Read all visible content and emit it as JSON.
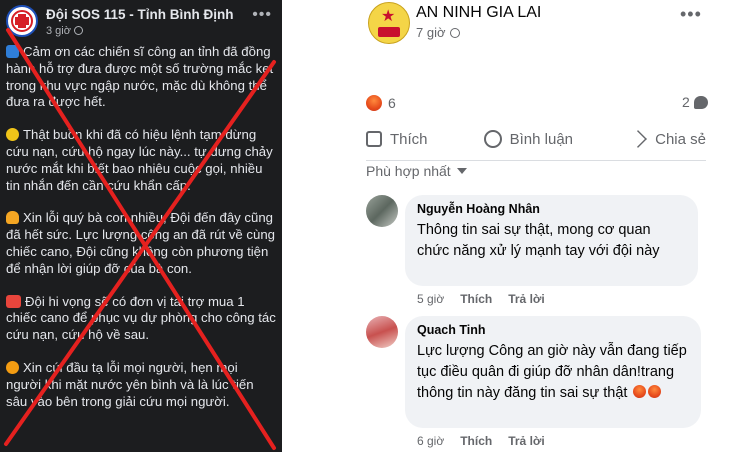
{
  "left_post": {
    "page_name": "Đội SOS 115 - Tỉnh Bình Định",
    "time": "3 giờ",
    "paragraphs": [
      "Cảm ơn các chiến sĩ công an tỉnh đã đồng hành hỗ trợ đưa được một số trường mắc kẹt trong khu vực ngập nước, mặc dù không thể đưa ra được hết.",
      "Thật buồn khi đã có hiệu lệnh tạm dừng cứu nạn, cứu hộ ngay lúc này... tự dưng chảy nước mắt khi biết bao nhiêu cuộc gọi, nhiều tin nhắn đến cần cứu khẩn cấp.",
      "Xin lỗi quý bà con nhiều, Đội đến đây cũng đã hết sức. Lực lượng công an đã rút về cùng chiếc cano, Đội cũng không còn phương tiện để nhận lời giúp đỡ của bà con.",
      "Đội hi vọng sẽ có đơn vị tài trợ mua 1 chiếc cano để phục vụ dự phòng cho công tác cứu nạn, cứu hộ về sau.",
      "Xin cúi đầu tạ lỗi mọi người, hẹn mọi người khi mặt nước yên bình và là lúc tiến sâu vào bên trong giải cứu mọi người."
    ],
    "emoji_icons": [
      "ship-icon",
      "sad-face-icon",
      "pray-icon",
      "sos-icon",
      "bowing-icon"
    ],
    "overlay_color": "#e5211f"
  },
  "right_post": {
    "page_name": "AN NINH GIA LAI",
    "time": "7 giờ",
    "reaction_count": "6",
    "comment_count": "2",
    "actions": {
      "like": "Thích",
      "comment": "Bình luận",
      "share": "Chia sẻ"
    },
    "sort_label": "Phù hợp nhất",
    "comments": [
      {
        "author": "Nguyễn Hoàng Nhân",
        "text": "Thông tin sai sự thật, mong cơ quan chức năng xử lý mạnh tay với đội này",
        "time": "5 giờ",
        "like": "Thích",
        "reply": "Trả lời"
      },
      {
        "author": "Quach Tinh",
        "text": "Lực lượng Công an giờ này vẫn đang tiếp tục điều quân đi giúp đỡ nhân dân!trang thông tin này đăng tin sai sự thật",
        "time": "6 giờ",
        "like": "Thích",
        "reply": "Trả lời"
      }
    ]
  },
  "colors": {
    "dark_bg": "#1c1d1f",
    "accent_red": "#e5211f",
    "comment_bubble": "#f0f2f5"
  }
}
